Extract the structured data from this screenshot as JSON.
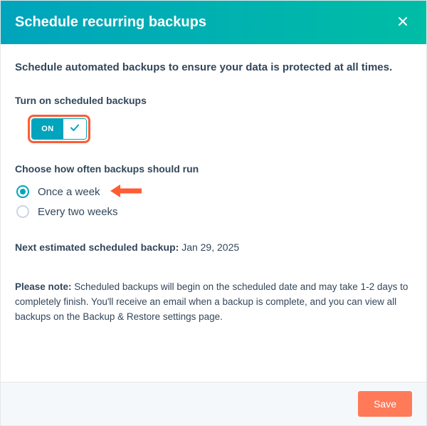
{
  "header": {
    "title": "Schedule recurring backups"
  },
  "intro": "Schedule automated backups to ensure your data is protected at all times.",
  "toggle": {
    "label": "Turn on scheduled backups",
    "on_text": "ON",
    "state": "on"
  },
  "frequency": {
    "label": "Choose how often backups should run",
    "options": [
      {
        "label": "Once a week",
        "selected": true
      },
      {
        "label": "Every two weeks",
        "selected": false
      }
    ]
  },
  "estimate": {
    "label": "Next estimated scheduled backup:",
    "value": "Jan 29, 2025"
  },
  "note": {
    "prefix": "Please note:",
    "text": "Scheduled backups will begin on the scheduled date and may take 1-2 days to completely finish. You'll receive an email when a backup is complete, and you can view all backups on the Backup & Restore settings page."
  },
  "footer": {
    "save_label": "Save"
  },
  "colors": {
    "accent_teal": "#00a4bd",
    "accent_orange": "#ff7a59",
    "highlight_orange": "#ff5c35"
  }
}
